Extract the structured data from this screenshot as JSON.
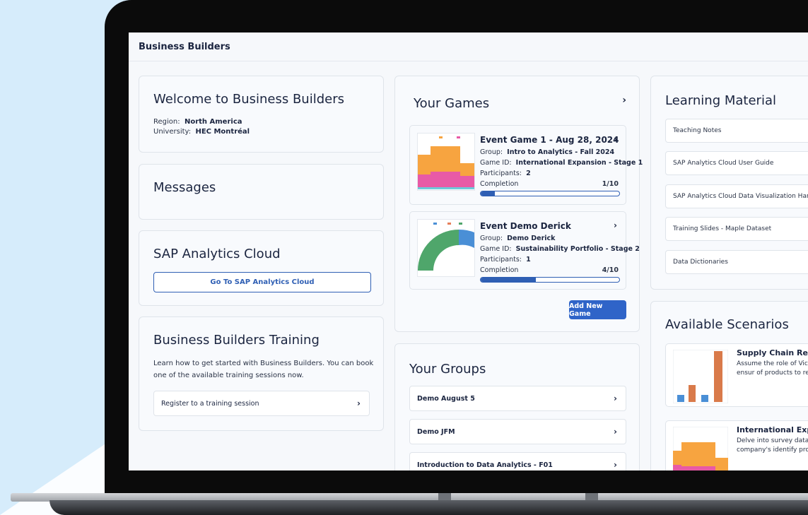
{
  "app": {
    "title": "Business Builders"
  },
  "welcome": {
    "title": "Welcome to Business Builders",
    "region_label": "Region:",
    "region_value": "North America",
    "university_label": "University:",
    "university_value": "HEC Montréal"
  },
  "messages": {
    "title": "Messages"
  },
  "sac": {
    "title": "SAP Analytics Cloud",
    "button": "Go To SAP Analytics Cloud"
  },
  "training": {
    "title": "Business Builders Training",
    "text": "Learn how to get started with Business Builders. You can book one of the available training sessions now.",
    "link": "Register to a training session"
  },
  "games": {
    "title": "Your Games",
    "add_button": "Add New Game",
    "items": [
      {
        "title": "Event Game 1 - Aug 28, 2024",
        "group_label": "Group:",
        "group": "Intro to Analytics - Fall 2024",
        "gameid_label": "Game ID:",
        "gameid": "International Expansion - Stage 1",
        "participants_label": "Participants:",
        "participants": "2",
        "completion_label": "Completion",
        "completion": "1/10",
        "progress": 0.1
      },
      {
        "title": "Event Demo Derick",
        "group_label": "Group:",
        "group": "Demo Derick",
        "gameid_label": "Game ID:",
        "gameid": "Sustainability Portfolio - Stage 2",
        "participants_label": "Participants:",
        "participants": "1",
        "completion_label": "Completion",
        "completion": "4/10",
        "progress": 0.4
      }
    ]
  },
  "groups": {
    "title": "Your Groups",
    "items": [
      "Demo August 5",
      "Demo JFM",
      "Introduction to Data Analytics - F01"
    ]
  },
  "learning": {
    "title": "Learning Material",
    "items": [
      "Teaching Notes",
      "SAP Analytics Cloud User Guide",
      "SAP Analytics Cloud Data Visualization Hand",
      "Training Slides - Maple Dataset",
      "Data Dictionaries"
    ]
  },
  "scenarios": {
    "title": "Available Scenarios",
    "items": [
      {
        "title": "Supply Chain Resil",
        "desc": "Assume the role of Vice your mission is to ensur of products to retailers"
      },
      {
        "title": "International Expar",
        "desc": "Delve into survey data to potential of a company's identify promising mark"
      }
    ]
  },
  "colors": {
    "accent": "#2f64c8",
    "orange": "#f7a440",
    "pink": "#e85aa6",
    "green": "#4fa66b",
    "blue": "#4a8fd6",
    "rust": "#d97a4a"
  },
  "icons": {
    "chevron": "chevron-right-icon"
  }
}
